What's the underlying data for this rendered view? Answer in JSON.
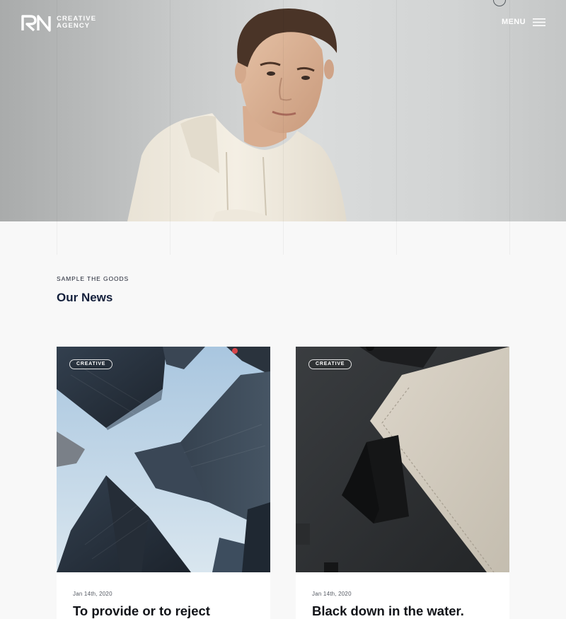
{
  "header": {
    "logo_line1": "CREATIVE",
    "logo_line2": "AGENCY",
    "menu_label": "MENU"
  },
  "news": {
    "eyebrow": "SAMPLE THE GOODS",
    "title": "Our News",
    "cards": [
      {
        "tag": "CREATIVE",
        "date": "Jan 14th, 2020",
        "title": "To provide or to reject"
      },
      {
        "tag": "CREATIVE",
        "date": "Jan 14th, 2020",
        "title": "Black down in the water."
      }
    ]
  },
  "colors": {
    "heading": "#14203c",
    "background": "#f8f8f8",
    "card": "#ffffff"
  }
}
